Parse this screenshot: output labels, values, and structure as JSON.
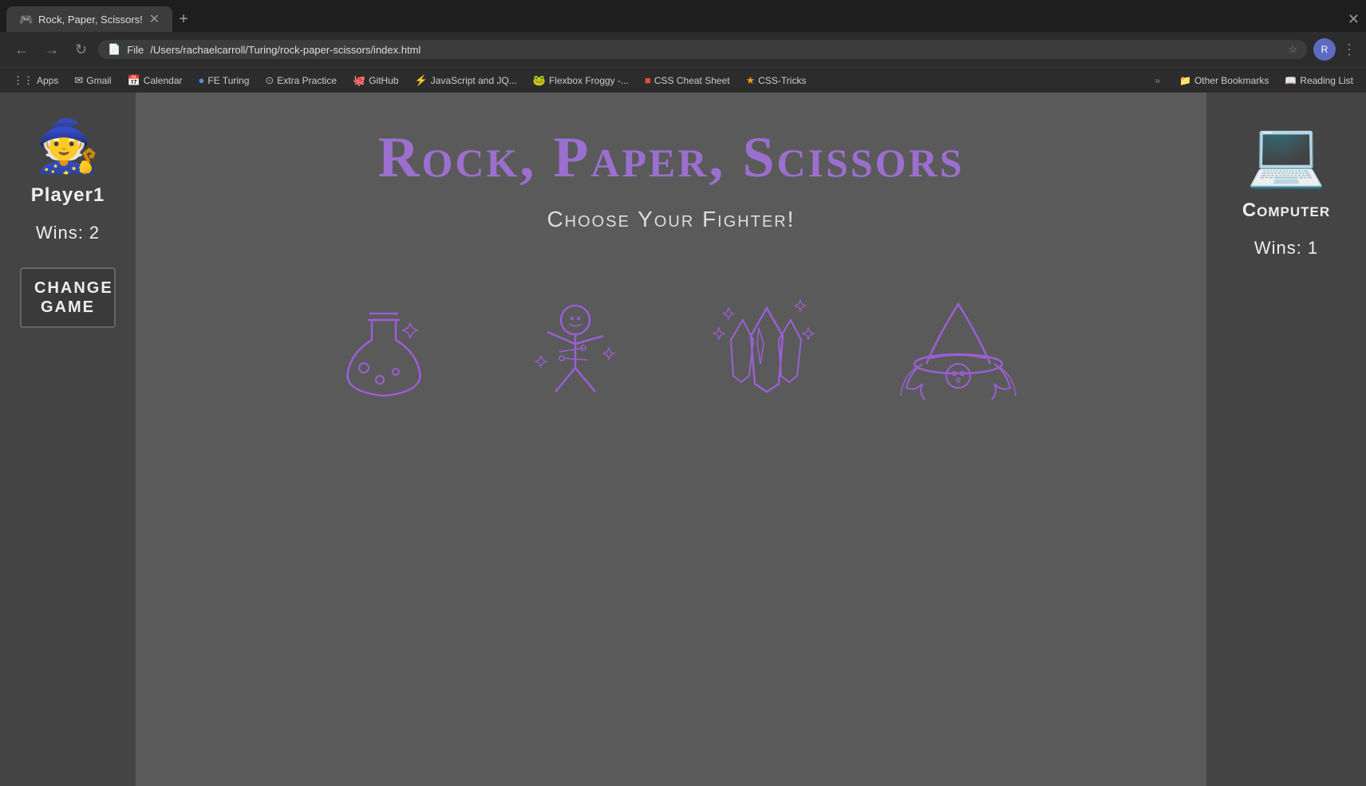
{
  "browser": {
    "tab": {
      "title": "Rock, Paper, Scissors!",
      "favicon": "🎮"
    },
    "address": "/Users/rachaelcarroll/Turing/rock-paper-scissors/index.html",
    "address_prefix": "File",
    "new_tab_label": "+",
    "bookmarks": [
      {
        "id": "apps",
        "label": "Apps",
        "favicon": "⋮⋮⋮"
      },
      {
        "id": "gmail",
        "label": "Gmail",
        "favicon": "✉"
      },
      {
        "id": "calendar",
        "label": "Calendar",
        "favicon": "📅"
      },
      {
        "id": "fe-turing",
        "label": "FE Turing",
        "favicon": "🔵"
      },
      {
        "id": "extra-practice",
        "label": "Extra Practice",
        "favicon": "⊙"
      },
      {
        "id": "github",
        "label": "GitHub",
        "favicon": "🐙"
      },
      {
        "id": "js-jquery",
        "label": "JavaScript and JQ...",
        "favicon": "⚡"
      },
      {
        "id": "flexbox-froggy",
        "label": "Flexbox Froggy -...",
        "favicon": "🐸"
      },
      {
        "id": "css-cheat",
        "label": "CSS Cheat Sheet",
        "favicon": "⬛"
      },
      {
        "id": "css-tricks",
        "label": "CSS-Tricks",
        "favicon": "⭐"
      }
    ],
    "bookmarks_more_label": "»",
    "other_bookmarks_label": "Other Bookmarks",
    "reading_list_label": "Reading List"
  },
  "game": {
    "title": "Rock, Paper, Scissors",
    "subtitle": "Choose Your Fighter!",
    "player": {
      "name": "Player1",
      "wins_label": "Wins: 2",
      "avatar": "🧙"
    },
    "computer": {
      "name": "Computer",
      "wins_label": "Wins: 1",
      "icon": "💻"
    },
    "change_game_label": "Change Game",
    "fighters": [
      {
        "id": "potion",
        "label": "Potion"
      },
      {
        "id": "voodoo",
        "label": "Voodoo Doll"
      },
      {
        "id": "crystal",
        "label": "Crystal"
      },
      {
        "id": "witch",
        "label": "Witch"
      }
    ]
  },
  "colors": {
    "purple": "#9b5fd4",
    "dark_bg": "#5a5a5a",
    "sidebar_bg": "#444444"
  }
}
